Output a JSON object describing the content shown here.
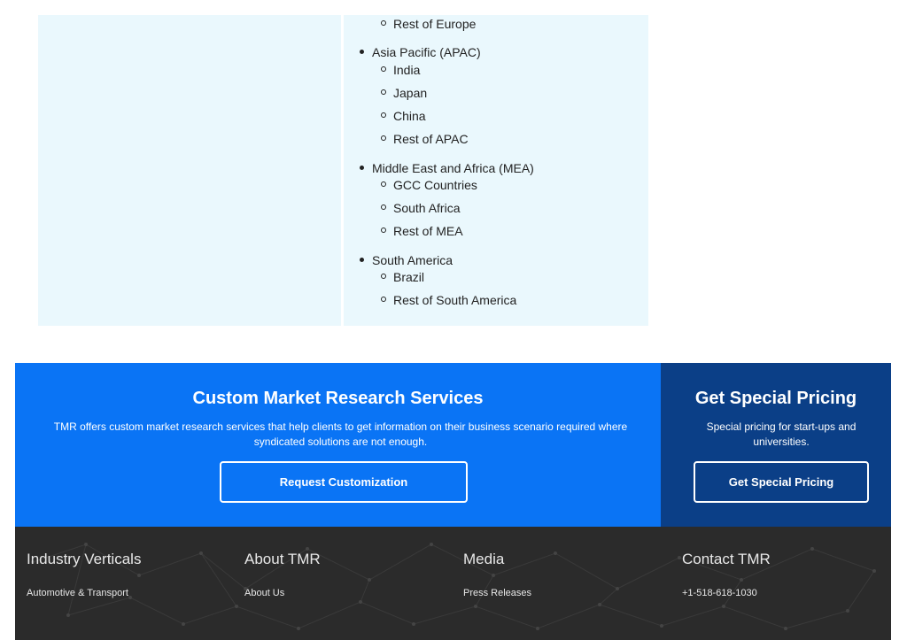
{
  "regions": [
    {
      "subs": [
        "Rest of Europe"
      ]
    },
    {
      "label": "Asia Pacific (APAC)",
      "subs": [
        "India",
        "Japan",
        "China",
        "Rest of APAC"
      ]
    },
    {
      "label": "Middle East and Africa (MEA)",
      "subs": [
        "GCC Countries",
        "South Africa",
        "Rest of MEA"
      ]
    },
    {
      "label": "South America",
      "subs": [
        "Brazil",
        "Rest of South America"
      ]
    }
  ],
  "cta": {
    "custom": {
      "title": "Custom Market Research Services",
      "description": "TMR offers custom market research services that help clients to get information on their business scenario required where syndicated solutions are not enough.",
      "button": "Request Customization"
    },
    "special": {
      "title": "Get Special Pricing",
      "description": "Special pricing for start-ups and universities.",
      "button": "Get Special Pricing"
    },
    "colors": {
      "primary": "#0a74f5",
      "dark": "#0b3f87"
    }
  },
  "footer": {
    "columns": [
      {
        "heading": "Industry Verticals",
        "link": "Automotive & Transport"
      },
      {
        "heading": "About TMR",
        "link": "About Us"
      },
      {
        "heading": "Media",
        "link": "Press Releases"
      },
      {
        "heading": "Contact TMR",
        "link": "+1-518-618-1030"
      }
    ]
  }
}
